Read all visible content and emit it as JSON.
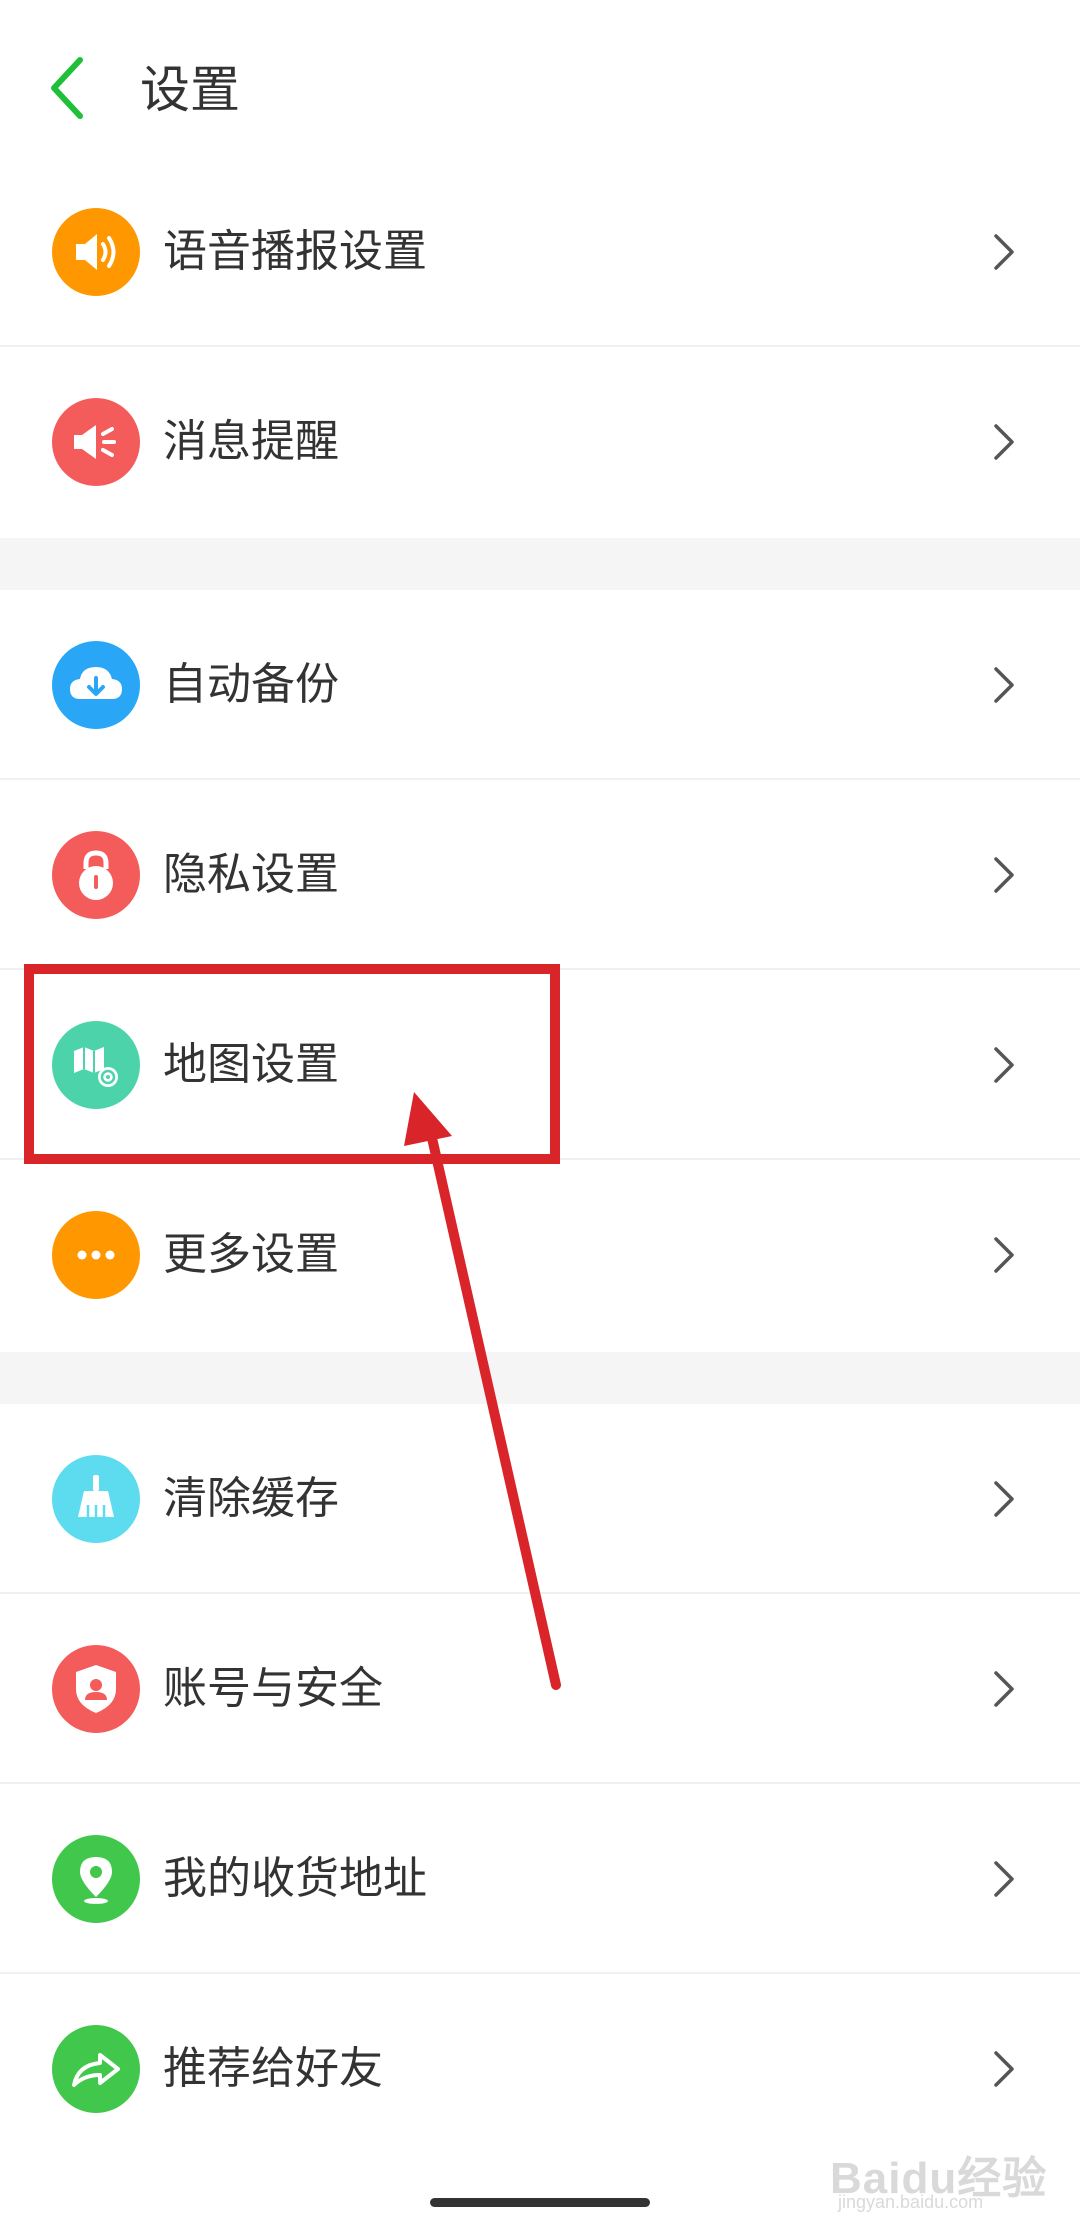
{
  "header": {
    "title": "设置",
    "back_icon": "chevron-left-icon",
    "accent_color": "#1fbf3a"
  },
  "sections": [
    {
      "items": [
        {
          "label": "语音播报设置",
          "icon": "speaker-icon",
          "icon_color": "#ff9800"
        },
        {
          "label": "消息提醒",
          "icon": "bell-speaker-icon",
          "icon_color": "#f45b5b"
        }
      ]
    },
    {
      "items": [
        {
          "label": "自动备份",
          "icon": "cloud-download-icon",
          "icon_color": "#29a6f5"
        },
        {
          "label": "隐私设置",
          "icon": "lock-icon",
          "icon_color": "#f45b5b"
        },
        {
          "label": "地图设置",
          "icon": "map-gear-icon",
          "icon_color": "#4cd3a9"
        },
        {
          "label": "更多设置",
          "icon": "more-dots-icon",
          "icon_color": "#ff9800"
        }
      ]
    },
    {
      "items": [
        {
          "label": "清除缓存",
          "icon": "broom-icon",
          "icon_color": "#5ddbef"
        },
        {
          "label": "账号与安全",
          "icon": "shield-user-icon",
          "icon_color": "#f45b5b"
        },
        {
          "label": "我的收货地址",
          "icon": "location-pin-icon",
          "icon_color": "#41c84c"
        },
        {
          "label": "推荐给好友",
          "icon": "share-arrow-icon",
          "icon_color": "#41c84c"
        }
      ]
    }
  ],
  "annotation": {
    "color": "#d9242a",
    "highlighted_item": "地图设置"
  },
  "watermark": {
    "text": "Baidu经验",
    "subtext": "jingyan.baidu.com"
  }
}
